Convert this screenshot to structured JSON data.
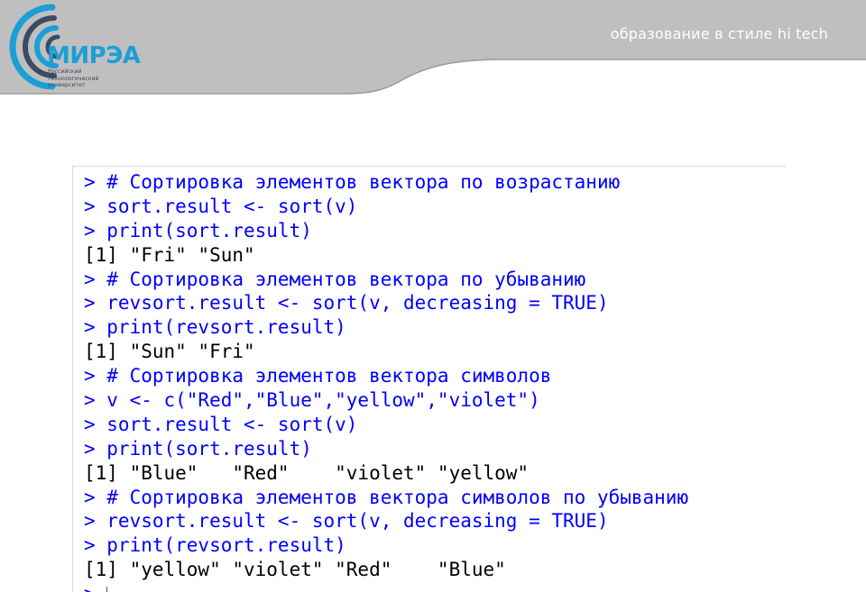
{
  "header": {
    "tagline": "образование в стиле hi tech",
    "logo": {
      "name": "МИРЭА",
      "subtitle_lines": [
        "Российский",
        "технологический",
        "университет"
      ]
    },
    "colors": {
      "band": "#bfbfbf",
      "logo_blue": "#1b9fd6",
      "logo_dark": "#3d4a63"
    }
  },
  "console": {
    "input_color": "#0000ff",
    "output_color": "#000000",
    "lines": [
      {
        "type": "input",
        "text": "> # Сортировка элементов вектора по возрастанию"
      },
      {
        "type": "input",
        "text": "> sort.result <- sort(v)"
      },
      {
        "type": "input",
        "text": "> print(sort.result)"
      },
      {
        "type": "output",
        "text": "[1] \"Fri\" \"Sun\""
      },
      {
        "type": "input",
        "text": "> # Сортировка элементов вектора по убыванию"
      },
      {
        "type": "input",
        "text": "> revsort.result <- sort(v, decreasing = TRUE)"
      },
      {
        "type": "input",
        "text": "> print(revsort.result)"
      },
      {
        "type": "output",
        "text": "[1] \"Sun\" \"Fri\""
      },
      {
        "type": "input",
        "text": "> # Сортировка элементов вектора символов"
      },
      {
        "type": "input",
        "text": "> v <- c(\"Red\",\"Blue\",\"yellow\",\"violet\")"
      },
      {
        "type": "input",
        "text": "> sort.result <- sort(v)"
      },
      {
        "type": "input",
        "text": "> print(sort.result)"
      },
      {
        "type": "output",
        "text": "[1] \"Blue\"   \"Red\"    \"violet\" \"yellow\""
      },
      {
        "type": "input",
        "text": "> # Сортировка элементов вектора символов по убыванию"
      },
      {
        "type": "input",
        "text": "> revsort.result <- sort(v, decreasing = TRUE)"
      },
      {
        "type": "input",
        "text": "> print(revsort.result)"
      },
      {
        "type": "output",
        "text": "[1] \"yellow\" \"violet\" \"Red\"    \"Blue\""
      }
    ],
    "prompt": ">"
  }
}
